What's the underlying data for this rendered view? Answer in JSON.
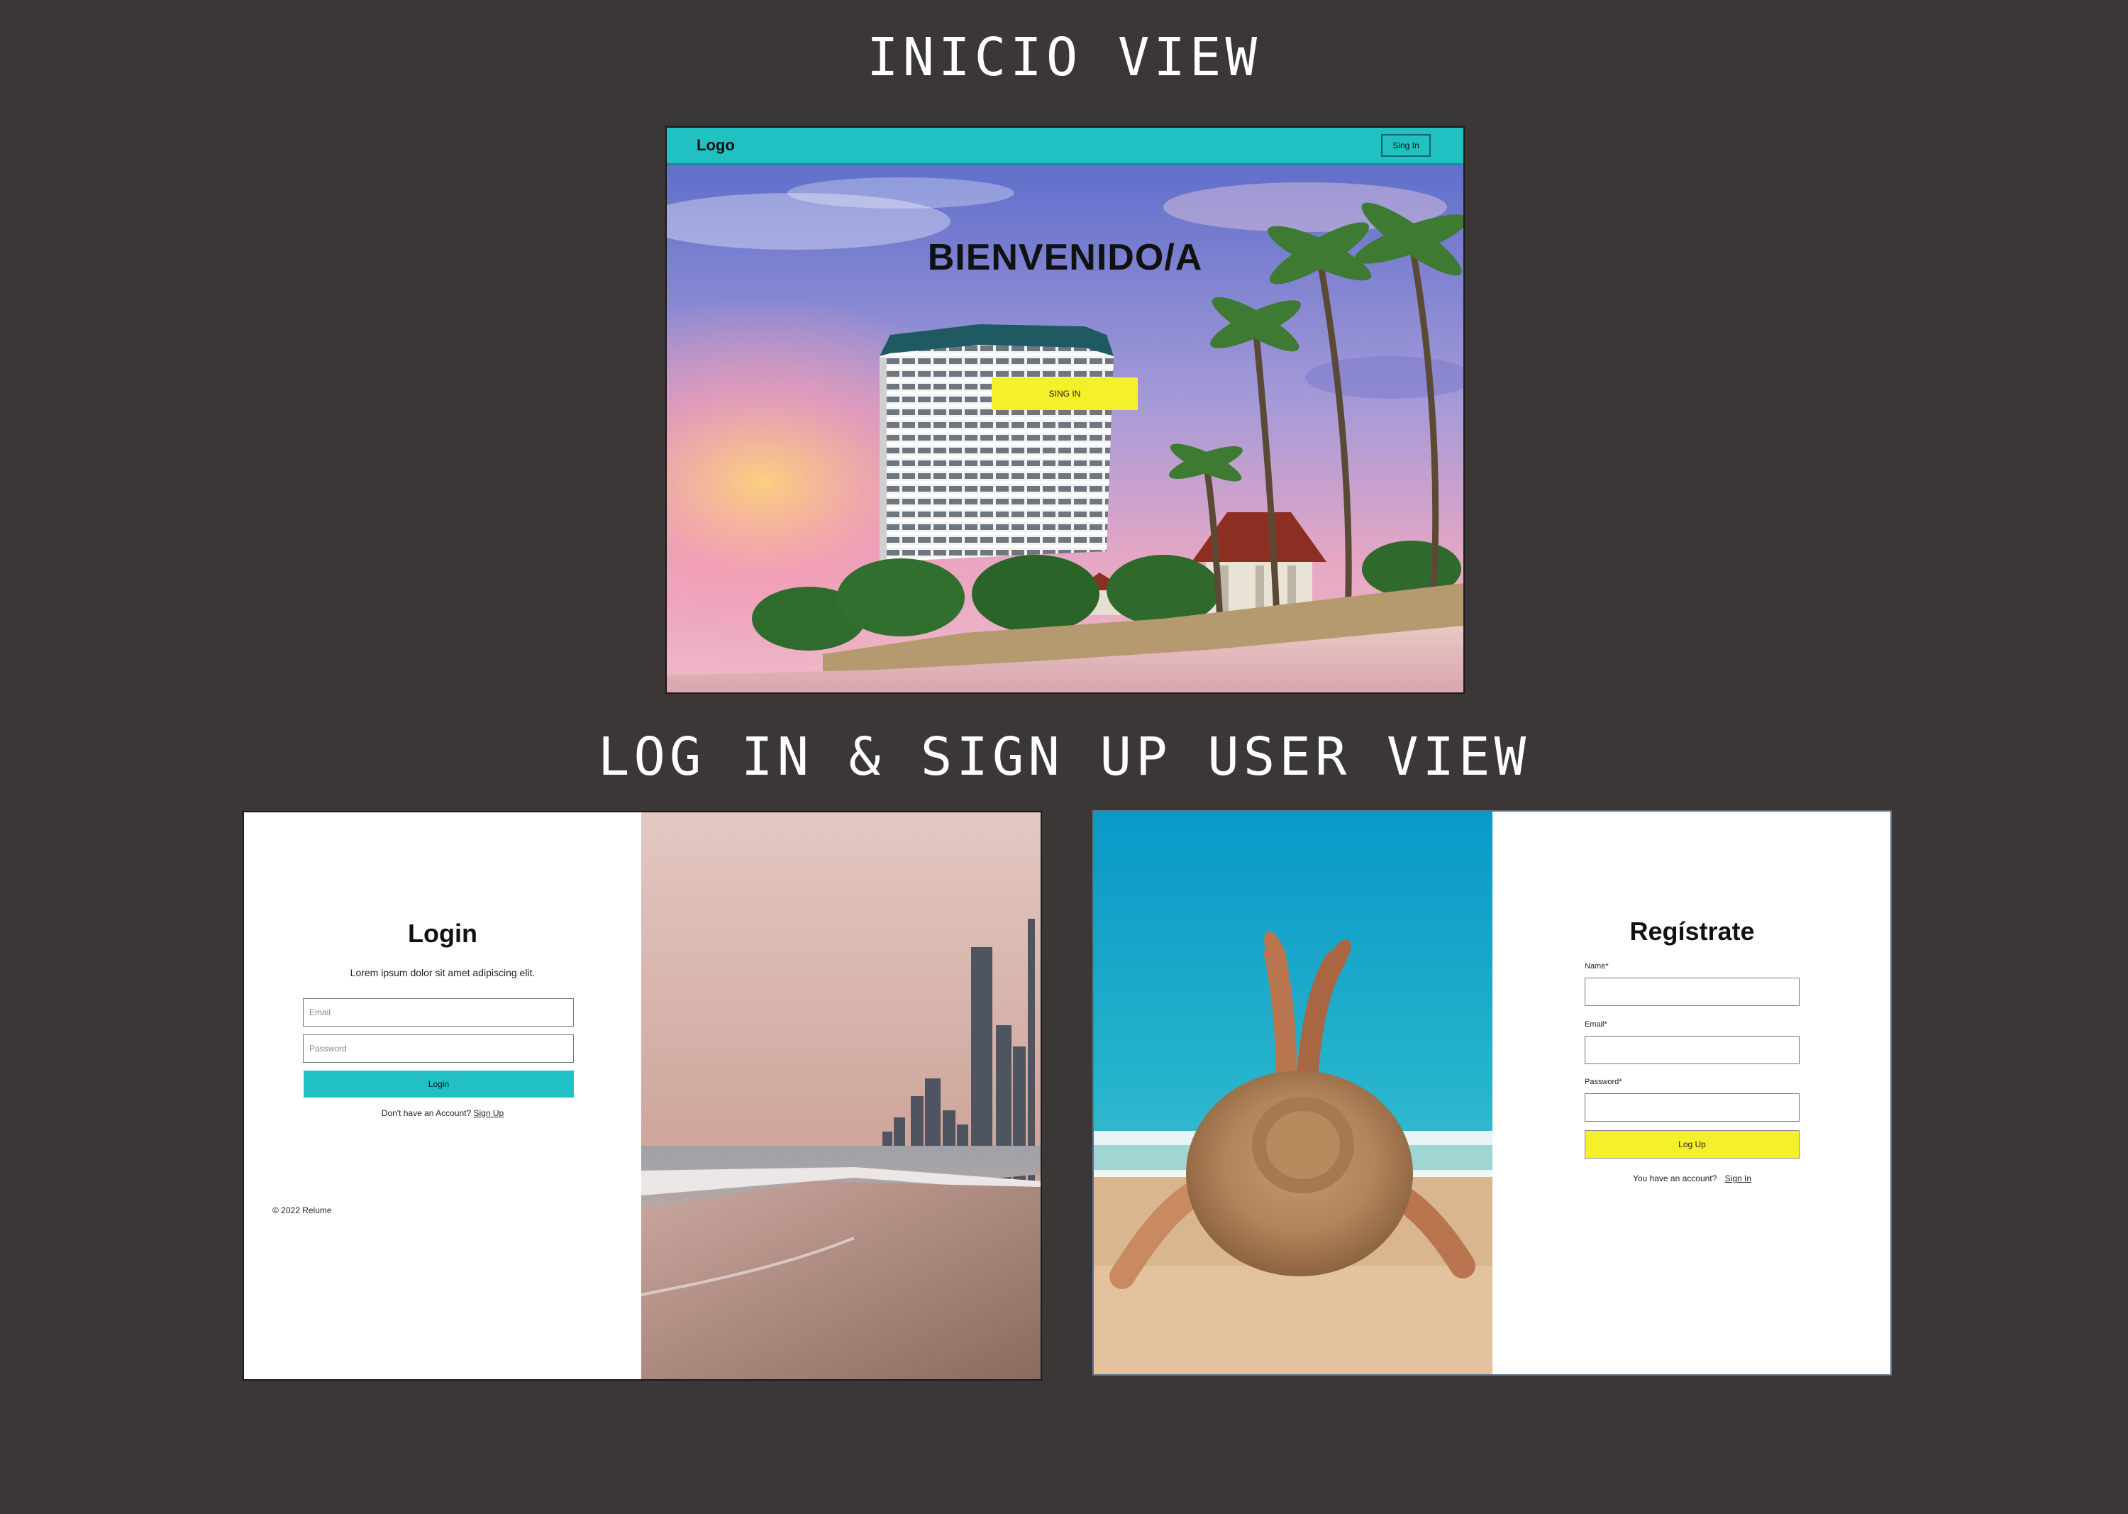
{
  "sections": {
    "inicio_title": "INICIO VIEW",
    "auth_title": "LOG IN & SIGN UP USER VIEW"
  },
  "inicio": {
    "logo": "Logo",
    "nav_signin": "Sing In",
    "hero_title": "BIENVENIDO/A",
    "hero_button": "SING IN"
  },
  "login": {
    "title": "Login",
    "subtitle": "Lorem ipsum dolor sit amet adipiscing elit.",
    "email_placeholder": "Email",
    "password_placeholder": "Password",
    "button": "Login",
    "no_account_text": "Don't have an Account?",
    "signup_link": "Sign Up",
    "footer": "© 2022 Relume"
  },
  "register": {
    "title": "Regístrate",
    "name_label": "Name*",
    "email_label": "Email*",
    "password_label": "Password*",
    "button": "Log Up",
    "have_account_text": "You have an account?",
    "signin_link": "Sign In"
  },
  "colors": {
    "background": "#3b3736",
    "accent_teal": "#21c1c3",
    "accent_yellow": "#f4f02a"
  }
}
